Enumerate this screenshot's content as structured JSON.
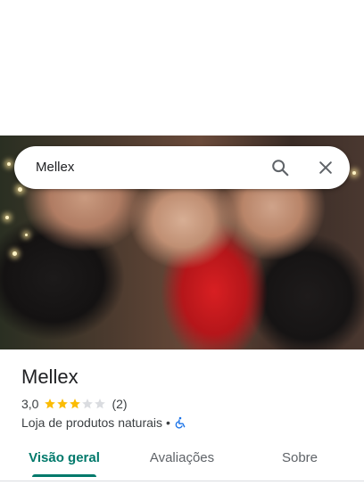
{
  "search": {
    "query": "Mellex"
  },
  "place": {
    "name": "Mellex",
    "rating_value": "3,0",
    "rating_stars": 3,
    "rating_max": 5,
    "review_count": "(2)",
    "category": "Loja de produtos naturais",
    "separator": "•"
  },
  "tabs": [
    {
      "label": "Visão geral",
      "active": true
    },
    {
      "label": "Avaliações",
      "active": false
    },
    {
      "label": "Sobre",
      "active": false
    }
  ],
  "colors": {
    "accent": "#00796b",
    "star_filled": "#fbbc04",
    "star_empty": "#dadce0",
    "accessibility_icon": "#1a73e8"
  },
  "icons": {
    "search": "search-icon",
    "close": "close-icon",
    "accessibility": "wheelchair-icon"
  }
}
